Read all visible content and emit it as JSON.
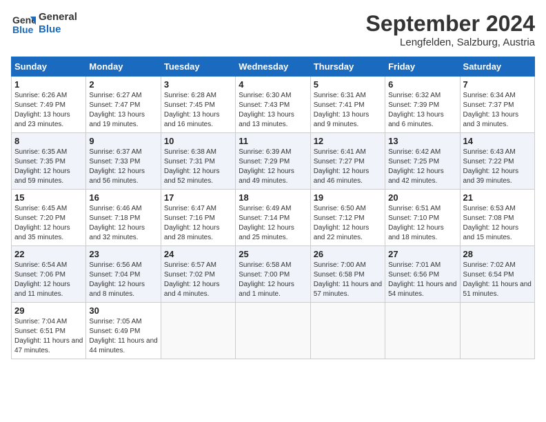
{
  "logo": {
    "line1": "General",
    "line2": "Blue"
  },
  "title": "September 2024",
  "subtitle": "Lengfelden, Salzburg, Austria",
  "days_of_week": [
    "Sunday",
    "Monday",
    "Tuesday",
    "Wednesday",
    "Thursday",
    "Friday",
    "Saturday"
  ],
  "weeks": [
    [
      {
        "day": "1",
        "sunrise": "Sunrise: 6:26 AM",
        "sunset": "Sunset: 7:49 PM",
        "daylight": "Daylight: 13 hours and 23 minutes."
      },
      {
        "day": "2",
        "sunrise": "Sunrise: 6:27 AM",
        "sunset": "Sunset: 7:47 PM",
        "daylight": "Daylight: 13 hours and 19 minutes."
      },
      {
        "day": "3",
        "sunrise": "Sunrise: 6:28 AM",
        "sunset": "Sunset: 7:45 PM",
        "daylight": "Daylight: 13 hours and 16 minutes."
      },
      {
        "day": "4",
        "sunrise": "Sunrise: 6:30 AM",
        "sunset": "Sunset: 7:43 PM",
        "daylight": "Daylight: 13 hours and 13 minutes."
      },
      {
        "day": "5",
        "sunrise": "Sunrise: 6:31 AM",
        "sunset": "Sunset: 7:41 PM",
        "daylight": "Daylight: 13 hours and 9 minutes."
      },
      {
        "day": "6",
        "sunrise": "Sunrise: 6:32 AM",
        "sunset": "Sunset: 7:39 PM",
        "daylight": "Daylight: 13 hours and 6 minutes."
      },
      {
        "day": "7",
        "sunrise": "Sunrise: 6:34 AM",
        "sunset": "Sunset: 7:37 PM",
        "daylight": "Daylight: 13 hours and 3 minutes."
      }
    ],
    [
      {
        "day": "8",
        "sunrise": "Sunrise: 6:35 AM",
        "sunset": "Sunset: 7:35 PM",
        "daylight": "Daylight: 12 hours and 59 minutes."
      },
      {
        "day": "9",
        "sunrise": "Sunrise: 6:37 AM",
        "sunset": "Sunset: 7:33 PM",
        "daylight": "Daylight: 12 hours and 56 minutes."
      },
      {
        "day": "10",
        "sunrise": "Sunrise: 6:38 AM",
        "sunset": "Sunset: 7:31 PM",
        "daylight": "Daylight: 12 hours and 52 minutes."
      },
      {
        "day": "11",
        "sunrise": "Sunrise: 6:39 AM",
        "sunset": "Sunset: 7:29 PM",
        "daylight": "Daylight: 12 hours and 49 minutes."
      },
      {
        "day": "12",
        "sunrise": "Sunrise: 6:41 AM",
        "sunset": "Sunset: 7:27 PM",
        "daylight": "Daylight: 12 hours and 46 minutes."
      },
      {
        "day": "13",
        "sunrise": "Sunrise: 6:42 AM",
        "sunset": "Sunset: 7:25 PM",
        "daylight": "Daylight: 12 hours and 42 minutes."
      },
      {
        "day": "14",
        "sunrise": "Sunrise: 6:43 AM",
        "sunset": "Sunset: 7:22 PM",
        "daylight": "Daylight: 12 hours and 39 minutes."
      }
    ],
    [
      {
        "day": "15",
        "sunrise": "Sunrise: 6:45 AM",
        "sunset": "Sunset: 7:20 PM",
        "daylight": "Daylight: 12 hours and 35 minutes."
      },
      {
        "day": "16",
        "sunrise": "Sunrise: 6:46 AM",
        "sunset": "Sunset: 7:18 PM",
        "daylight": "Daylight: 12 hours and 32 minutes."
      },
      {
        "day": "17",
        "sunrise": "Sunrise: 6:47 AM",
        "sunset": "Sunset: 7:16 PM",
        "daylight": "Daylight: 12 hours and 28 minutes."
      },
      {
        "day": "18",
        "sunrise": "Sunrise: 6:49 AM",
        "sunset": "Sunset: 7:14 PM",
        "daylight": "Daylight: 12 hours and 25 minutes."
      },
      {
        "day": "19",
        "sunrise": "Sunrise: 6:50 AM",
        "sunset": "Sunset: 7:12 PM",
        "daylight": "Daylight: 12 hours and 22 minutes."
      },
      {
        "day": "20",
        "sunrise": "Sunrise: 6:51 AM",
        "sunset": "Sunset: 7:10 PM",
        "daylight": "Daylight: 12 hours and 18 minutes."
      },
      {
        "day": "21",
        "sunrise": "Sunrise: 6:53 AM",
        "sunset": "Sunset: 7:08 PM",
        "daylight": "Daylight: 12 hours and 15 minutes."
      }
    ],
    [
      {
        "day": "22",
        "sunrise": "Sunrise: 6:54 AM",
        "sunset": "Sunset: 7:06 PM",
        "daylight": "Daylight: 12 hours and 11 minutes."
      },
      {
        "day": "23",
        "sunrise": "Sunrise: 6:56 AM",
        "sunset": "Sunset: 7:04 PM",
        "daylight": "Daylight: 12 hours and 8 minutes."
      },
      {
        "day": "24",
        "sunrise": "Sunrise: 6:57 AM",
        "sunset": "Sunset: 7:02 PM",
        "daylight": "Daylight: 12 hours and 4 minutes."
      },
      {
        "day": "25",
        "sunrise": "Sunrise: 6:58 AM",
        "sunset": "Sunset: 7:00 PM",
        "daylight": "Daylight: 12 hours and 1 minute."
      },
      {
        "day": "26",
        "sunrise": "Sunrise: 7:00 AM",
        "sunset": "Sunset: 6:58 PM",
        "daylight": "Daylight: 11 hours and 57 minutes."
      },
      {
        "day": "27",
        "sunrise": "Sunrise: 7:01 AM",
        "sunset": "Sunset: 6:56 PM",
        "daylight": "Daylight: 11 hours and 54 minutes."
      },
      {
        "day": "28",
        "sunrise": "Sunrise: 7:02 AM",
        "sunset": "Sunset: 6:54 PM",
        "daylight": "Daylight: 11 hours and 51 minutes."
      }
    ],
    [
      {
        "day": "29",
        "sunrise": "Sunrise: 7:04 AM",
        "sunset": "Sunset: 6:51 PM",
        "daylight": "Daylight: 11 hours and 47 minutes."
      },
      {
        "day": "30",
        "sunrise": "Sunrise: 7:05 AM",
        "sunset": "Sunset: 6:49 PM",
        "daylight": "Daylight: 11 hours and 44 minutes."
      },
      null,
      null,
      null,
      null,
      null
    ]
  ]
}
